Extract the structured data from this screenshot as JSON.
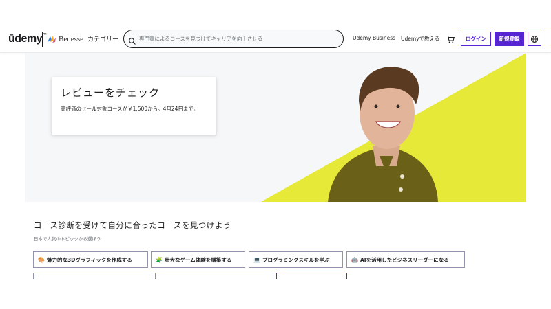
{
  "header": {
    "logo": "ūdemy",
    "logo_mark": "™",
    "partner": "Benesse",
    "category": "カテゴリー",
    "search_placeholder": "専門家によるコースを見つけてキャリアを向上させる",
    "business": "Udemy Business",
    "teach": "Udemyで教える",
    "login": "ログイン",
    "signup": "新規登録"
  },
  "banner": {
    "title": "レビューをチェック",
    "text": "高評価のセール対象コースが￥1,500から。4月24日まで。",
    "accent_color": "#e4e835"
  },
  "section": {
    "title": "コース診断を受けて自分に合ったコースを見つけよう",
    "subtitle": "日本で人気のトピックから選ぼう",
    "chips": [
      {
        "emoji": "🎨",
        "label": "魅力的な3Dグラフィックを作成する"
      },
      {
        "emoji": "🧩",
        "label": "壮大なゲーム体験を構築する"
      },
      {
        "emoji": "💻",
        "label": "プログラミングスキルを学ぶ"
      },
      {
        "emoji": "🤖",
        "label": "AIを活用したビジネスリーダーになる"
      }
    ]
  },
  "colors": {
    "brand": "#5624d0",
    "text": "#1c1d1f"
  }
}
